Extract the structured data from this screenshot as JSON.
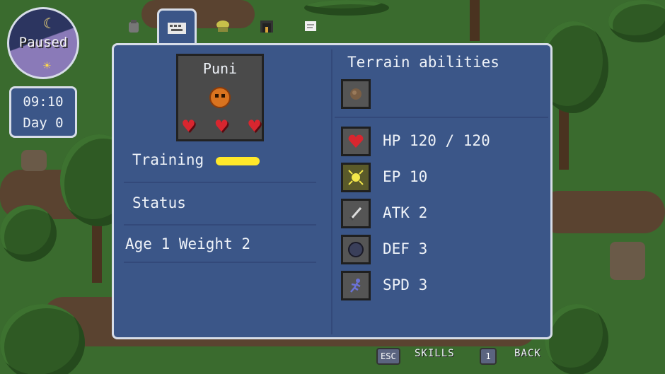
{
  "hud": {
    "clock_label": "Paused",
    "time": "09:10",
    "day": "Day 0"
  },
  "tabs": [
    {
      "icon": "bag-icon"
    },
    {
      "icon": "keyboard-icon",
      "active": true
    },
    {
      "icon": "creature-icon"
    },
    {
      "icon": "home-icon"
    },
    {
      "icon": "scroll-icon"
    }
  ],
  "creature": {
    "name": "Puni",
    "hearts": 3,
    "training_label": "Training",
    "status_label": "Status",
    "age_weight": "Age 1 Weight 2"
  },
  "terrain": {
    "title": "Terrain abilities",
    "ability_icon": "rock-icon"
  },
  "stats": [
    {
      "icon": "heart-icon",
      "text": "HP 120 / 120"
    },
    {
      "icon": "energy-icon",
      "text": "EP 10"
    },
    {
      "icon": "sword-icon",
      "text": "ATK 2"
    },
    {
      "icon": "shield-orb-icon",
      "text": "DEF 3"
    },
    {
      "icon": "running-icon",
      "text": "SPD 3"
    }
  ],
  "footer": {
    "esc_key": "ESC",
    "skills_label": "SKILLS",
    "one_key": "1",
    "back_label": "BACK"
  },
  "colors": {
    "panel": "#3b5688",
    "border": "#d7dde8",
    "training_bar": "#ffe82a",
    "heart": "#d8262f"
  }
}
